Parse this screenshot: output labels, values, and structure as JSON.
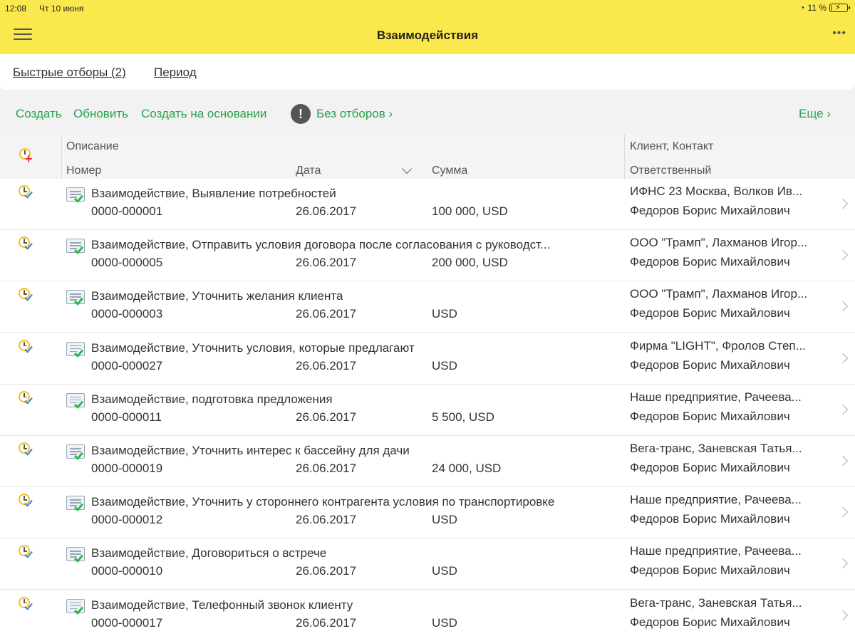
{
  "status_bar": {
    "time": "12:08",
    "date": "Чт 10 июня",
    "battery": "11 %",
    "battery_level": 0.11
  },
  "header": {
    "title": "Взаимодействия",
    "more": "•••"
  },
  "filters": {
    "quick": "Быстрые отборы (2)",
    "period": "Период"
  },
  "commands": {
    "create": "Создать",
    "refresh": "Обновить",
    "create_based": "Создать на основании",
    "warning": "!",
    "no_filters": "Без отборов",
    "more": "Еще"
  },
  "columns": {
    "description": "Описание",
    "number": "Номер",
    "date": "Дата",
    "sum": "Сумма",
    "client_contact": "Клиент, Контакт",
    "responsible": "Ответственный"
  },
  "rows": [
    {
      "description": "Взаимодействие, Выявление потребностей",
      "number": "0000-000001",
      "date": "26.06.2017",
      "sum": "100 000, USD",
      "client": "ИФНС 23 Москва, Волков Ив...",
      "responsible": "Федоров Борис Михайлович"
    },
    {
      "description": "Взаимодействие, Отправить условия договора после согласования с руководст...",
      "number": "0000-000005",
      "date": "26.06.2017",
      "sum": "200 000, USD",
      "client": "ООО \"Трамп\", Лахманов Игор...",
      "responsible": "Федоров Борис Михайлович"
    },
    {
      "description": "Взаимодействие, Уточнить желания клиента",
      "number": "0000-000003",
      "date": "26.06.2017",
      "sum": "USD",
      "client": "ООО \"Трамп\", Лахманов Игор...",
      "responsible": "Федоров Борис Михайлович"
    },
    {
      "description": "Взаимодействие, Уточнить условия, которые предлагают",
      "number": "0000-000027",
      "date": "26.06.2017",
      "sum": "USD",
      "client": "Фирма \"LIGHT\", Фролов Степ...",
      "responsible": "Федоров Борис Михайлович"
    },
    {
      "description": "Взаимодействие, подготовка предложения",
      "number": "0000-000011",
      "date": "26.06.2017",
      "sum": "5 500, USD",
      "client": "Наше предприятие, Рачеева...",
      "responsible": "Федоров Борис Михайлович"
    },
    {
      "description": "Взаимодействие, Уточнить интерес к бассейну для дачи",
      "number": "0000-000019",
      "date": "26.06.2017",
      "sum": "24 000, USD",
      "client": "Вега-транс, Заневская Татья...",
      "responsible": "Федоров Борис Михайлович"
    },
    {
      "description": "Взаимодействие, Уточнить у стороннего контрагента условия по транспортировке",
      "number": "0000-000012",
      "date": "26.06.2017",
      "sum": "USD",
      "client": "Наше предприятие, Рачеева...",
      "responsible": "Федоров Борис Михайлович"
    },
    {
      "description": "Взаимодействие, Договориться о встрече",
      "number": "0000-000010",
      "date": "26.06.2017",
      "sum": "USD",
      "client": "Наше предприятие, Рачеева...",
      "responsible": "Федоров Борис Михайлович"
    },
    {
      "description": "Взаимодействие, Телефонный звонок клиенту",
      "number": "0000-000017",
      "date": "26.06.2017",
      "sum": "USD",
      "client": "Вега-транс, Заневская Татья...",
      "responsible": "Федоров Борис Михайлович"
    }
  ],
  "colors": {
    "header_bg": "#fbe84c",
    "accent_green": "#2aa14c"
  }
}
